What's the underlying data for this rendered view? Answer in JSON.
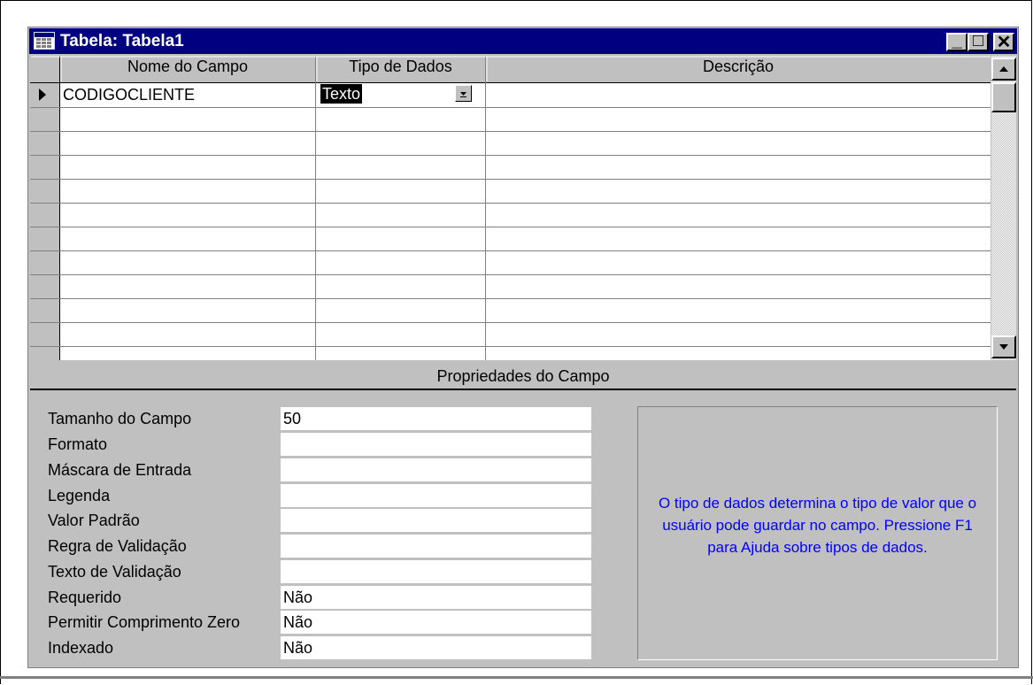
{
  "window": {
    "title": "Tabela: Tabela1"
  },
  "title_buttons": {
    "minimize": "_",
    "maximize": "□",
    "close": "✕"
  },
  "grid": {
    "columns": [
      "Nome do Campo",
      "Tipo de Dados",
      "Descrição"
    ],
    "rows": [
      {
        "name": "CODIGOCLIENTE",
        "type": "Texto",
        "description": ""
      }
    ]
  },
  "field_properties": {
    "title": "Propriedades do Campo",
    "items": [
      {
        "label": "Tamanho do Campo",
        "value": "50"
      },
      {
        "label": "Formato",
        "value": ""
      },
      {
        "label": "Máscara de Entrada",
        "value": ""
      },
      {
        "label": "Legenda",
        "value": ""
      },
      {
        "label": "Valor Padrão",
        "value": ""
      },
      {
        "label": "Regra de Validação",
        "value": ""
      },
      {
        "label": "Texto de Validação",
        "value": ""
      },
      {
        "label": "Requerido",
        "value": "Não"
      },
      {
        "label": "Permitir Comprimento Zero",
        "value": "Não"
      },
      {
        "label": "Indexado",
        "value": "Não"
      }
    ],
    "help_text": "O tipo de dados determina o tipo de valor que o usuário pode guardar no campo. Pressione F1 para Ajuda sobre tipos de dados."
  },
  "colors": {
    "title_bar": "#000080",
    "help_text": "#0000ff",
    "selection": "#000000"
  },
  "icons": [
    "table-icon",
    "minimize-icon",
    "maximize-icon",
    "close-icon",
    "row-selector-arrow-icon",
    "dropdown-arrow-icon",
    "scroll-up-icon",
    "scroll-down-icon"
  ]
}
